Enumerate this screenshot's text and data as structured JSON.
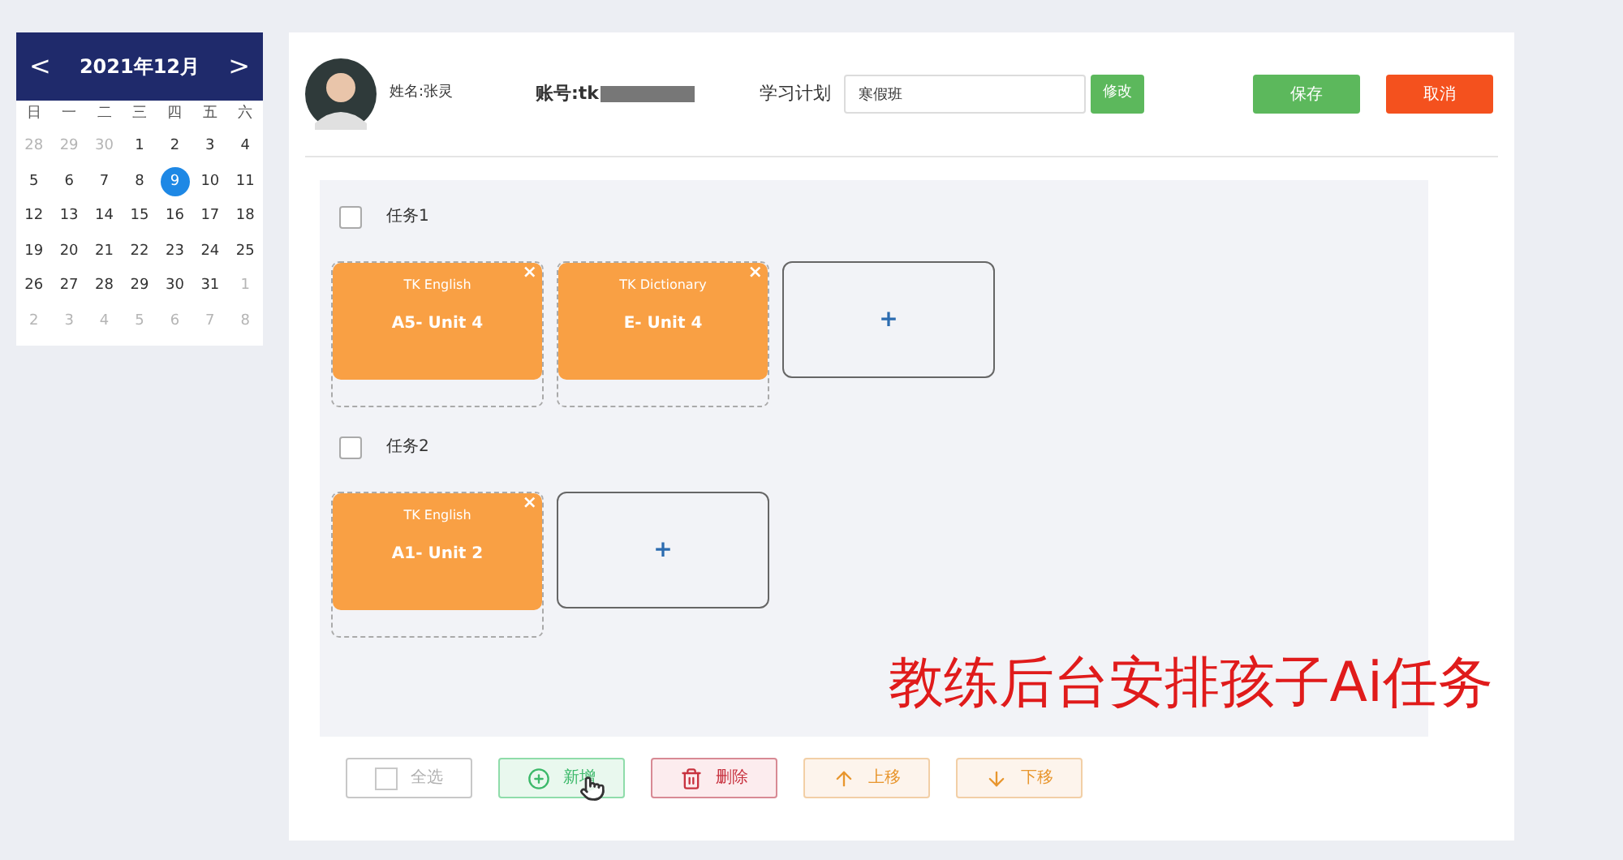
{
  "calendar": {
    "title": "2021年12月",
    "prev": "<",
    "next": ">",
    "weekdays": [
      "日",
      "一",
      "二",
      "三",
      "四",
      "五",
      "六"
    ],
    "days": [
      {
        "label": "28",
        "kind": "other",
        "selected": false
      },
      {
        "label": "29",
        "kind": "other",
        "selected": false
      },
      {
        "label": "30",
        "kind": "other",
        "selected": false
      },
      {
        "label": "1",
        "kind": "current",
        "selected": false
      },
      {
        "label": "2",
        "kind": "current",
        "selected": false
      },
      {
        "label": "3",
        "kind": "current",
        "selected": false
      },
      {
        "label": "4",
        "kind": "current",
        "selected": false
      },
      {
        "label": "5",
        "kind": "current",
        "selected": false
      },
      {
        "label": "6",
        "kind": "current",
        "selected": false
      },
      {
        "label": "7",
        "kind": "current",
        "selected": false
      },
      {
        "label": "8",
        "kind": "current",
        "selected": false
      },
      {
        "label": "9",
        "kind": "current",
        "selected": true
      },
      {
        "label": "10",
        "kind": "current",
        "selected": false
      },
      {
        "label": "11",
        "kind": "current",
        "selected": false
      },
      {
        "label": "12",
        "kind": "current",
        "selected": false
      },
      {
        "label": "13",
        "kind": "current",
        "selected": false
      },
      {
        "label": "14",
        "kind": "current",
        "selected": false
      },
      {
        "label": "15",
        "kind": "current",
        "selected": false
      },
      {
        "label": "16",
        "kind": "current",
        "selected": false
      },
      {
        "label": "17",
        "kind": "current",
        "selected": false
      },
      {
        "label": "18",
        "kind": "current",
        "selected": false
      },
      {
        "label": "19",
        "kind": "current",
        "selected": false
      },
      {
        "label": "20",
        "kind": "current",
        "selected": false
      },
      {
        "label": "21",
        "kind": "current",
        "selected": false
      },
      {
        "label": "22",
        "kind": "current",
        "selected": false
      },
      {
        "label": "23",
        "kind": "current",
        "selected": false
      },
      {
        "label": "24",
        "kind": "current",
        "selected": false
      },
      {
        "label": "25",
        "kind": "current",
        "selected": false
      },
      {
        "label": "26",
        "kind": "current",
        "selected": false
      },
      {
        "label": "27",
        "kind": "current",
        "selected": false
      },
      {
        "label": "28",
        "kind": "current",
        "selected": false
      },
      {
        "label": "29",
        "kind": "current",
        "selected": false
      },
      {
        "label": "30",
        "kind": "current",
        "selected": false
      },
      {
        "label": "31",
        "kind": "current",
        "selected": false
      },
      {
        "label": "1",
        "kind": "other",
        "selected": false
      },
      {
        "label": "2",
        "kind": "other",
        "selected": false
      },
      {
        "label": "3",
        "kind": "other",
        "selected": false
      },
      {
        "label": "4",
        "kind": "other",
        "selected": false
      },
      {
        "label": "5",
        "kind": "other",
        "selected": false
      },
      {
        "label": "6",
        "kind": "other",
        "selected": false
      },
      {
        "label": "7",
        "kind": "other",
        "selected": false
      },
      {
        "label": "8",
        "kind": "other",
        "selected": false
      }
    ]
  },
  "header": {
    "name": "姓名:张灵",
    "account": "账号:tk",
    "plan_label": "学习计划",
    "plan_value": "寒假班",
    "edit": "修改",
    "save": "保存",
    "cancel": "取消"
  },
  "tasks": [
    {
      "label": "任务1",
      "checked": false,
      "items": [
        {
          "course": "TK English",
          "unit": "A5- Unit 4",
          "close": "×"
        },
        {
          "course": "TK Dictionary",
          "unit": "E- Unit 4",
          "close": "×"
        }
      ],
      "add": "+"
    },
    {
      "label": "任务2",
      "checked": false,
      "items": [
        {
          "course": "TK English",
          "unit": "A1- Unit 2",
          "close": "×"
        }
      ],
      "add": "+"
    }
  ],
  "caption": "教练后台安排孩子Ai任务",
  "actions": [
    {
      "label": "全选",
      "kind": "select_all"
    },
    {
      "label": "新增",
      "kind": "add"
    },
    {
      "label": "删除",
      "kind": "delete"
    },
    {
      "label": "上移",
      "kind": "up"
    },
    {
      "label": "下移",
      "kind": "down"
    }
  ]
}
